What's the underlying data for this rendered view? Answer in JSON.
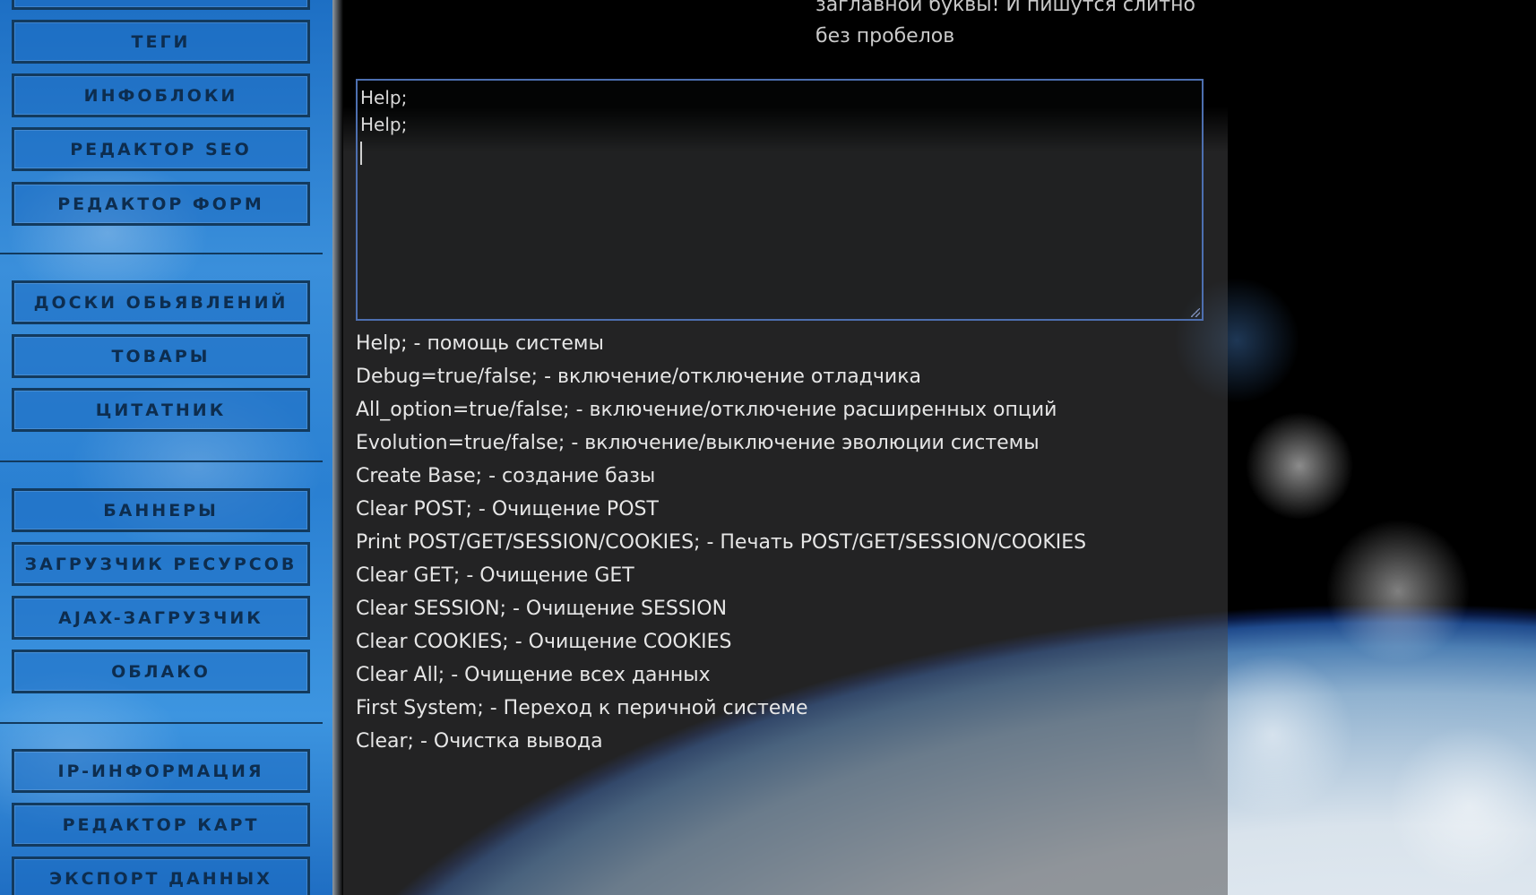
{
  "sidebar": {
    "buttons": [
      {
        "label": ""
      },
      {
        "label": "ТЕГИ"
      },
      {
        "label": "ИНФОБЛОКИ"
      },
      {
        "label": "РЕДАКТОР SEO"
      },
      {
        "label": "РЕДАКТОР ФОРМ"
      },
      {
        "label": "ДОСКИ ОБЬЯВЛЕНИЙ"
      },
      {
        "label": "ТОВАРЫ"
      },
      {
        "label": "ЦИТАТНИК"
      },
      {
        "label": "БАННЕРЫ"
      },
      {
        "label": "ЗАГРУЗЧИК РЕСУРСОВ"
      },
      {
        "label": "AJAX-ЗАГРУЗЧИК"
      },
      {
        "label": "ОБЛАКО"
      },
      {
        "label": "IP-ИНФОРМАЦИЯ"
      },
      {
        "label": "РЕДАКТОР КАРТ"
      },
      {
        "label": "ЭКСПОРТ ДАННЫХ"
      }
    ]
  },
  "hint": {
    "line1": "заглавной буквы! И пишутся слитно",
    "line2": "без пробелов"
  },
  "console": {
    "lines": [
      "Help;",
      "Help;"
    ]
  },
  "help": {
    "items": [
      "Help; - помощь системы",
      "Debug=true/false; - включение/отключение отладчика",
      "All_option=true/false; - включение/отключение расширенных опций",
      "Evolution=true/false; - включение/выключение эволюции системы",
      "Create Base; - создание базы",
      "Clear POST; - Очищение POST",
      "Print POST/GET/SESSION/COOKIES; - Печать POST/GET/SESSION/COOKIES",
      "Clear GET; - Очищение GET",
      "Clear SESSION; - Очищение SESSION",
      "Clear COOKIES; - Очищение COOKIES",
      "Clear All; - Очищение всех данных",
      "First System; - Переход к перичной системе",
      "Clear; - Очистка вывода"
    ]
  },
  "colors": {
    "sidebar_blue": "#2a80d2",
    "button_border": "#123a5e",
    "console_border": "#4d6fb0"
  }
}
